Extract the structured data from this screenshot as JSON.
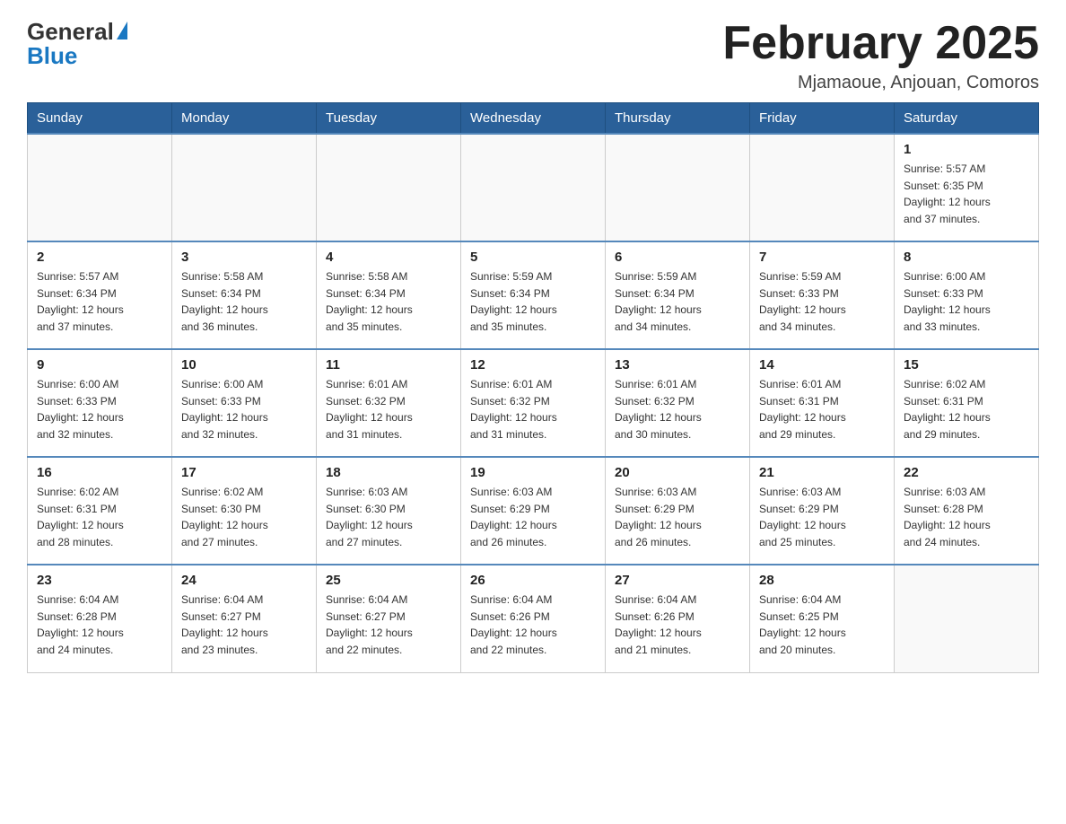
{
  "header": {
    "logo_general": "General",
    "logo_blue": "Blue",
    "month_title": "February 2025",
    "location": "Mjamaoue, Anjouan, Comoros"
  },
  "days_of_week": [
    "Sunday",
    "Monday",
    "Tuesday",
    "Wednesday",
    "Thursday",
    "Friday",
    "Saturday"
  ],
  "weeks": [
    [
      {
        "day": "",
        "info": ""
      },
      {
        "day": "",
        "info": ""
      },
      {
        "day": "",
        "info": ""
      },
      {
        "day": "",
        "info": ""
      },
      {
        "day": "",
        "info": ""
      },
      {
        "day": "",
        "info": ""
      },
      {
        "day": "1",
        "info": "Sunrise: 5:57 AM\nSunset: 6:35 PM\nDaylight: 12 hours\nand 37 minutes."
      }
    ],
    [
      {
        "day": "2",
        "info": "Sunrise: 5:57 AM\nSunset: 6:34 PM\nDaylight: 12 hours\nand 37 minutes."
      },
      {
        "day": "3",
        "info": "Sunrise: 5:58 AM\nSunset: 6:34 PM\nDaylight: 12 hours\nand 36 minutes."
      },
      {
        "day": "4",
        "info": "Sunrise: 5:58 AM\nSunset: 6:34 PM\nDaylight: 12 hours\nand 35 minutes."
      },
      {
        "day": "5",
        "info": "Sunrise: 5:59 AM\nSunset: 6:34 PM\nDaylight: 12 hours\nand 35 minutes."
      },
      {
        "day": "6",
        "info": "Sunrise: 5:59 AM\nSunset: 6:34 PM\nDaylight: 12 hours\nand 34 minutes."
      },
      {
        "day": "7",
        "info": "Sunrise: 5:59 AM\nSunset: 6:33 PM\nDaylight: 12 hours\nand 34 minutes."
      },
      {
        "day": "8",
        "info": "Sunrise: 6:00 AM\nSunset: 6:33 PM\nDaylight: 12 hours\nand 33 minutes."
      }
    ],
    [
      {
        "day": "9",
        "info": "Sunrise: 6:00 AM\nSunset: 6:33 PM\nDaylight: 12 hours\nand 32 minutes."
      },
      {
        "day": "10",
        "info": "Sunrise: 6:00 AM\nSunset: 6:33 PM\nDaylight: 12 hours\nand 32 minutes."
      },
      {
        "day": "11",
        "info": "Sunrise: 6:01 AM\nSunset: 6:32 PM\nDaylight: 12 hours\nand 31 minutes."
      },
      {
        "day": "12",
        "info": "Sunrise: 6:01 AM\nSunset: 6:32 PM\nDaylight: 12 hours\nand 31 minutes."
      },
      {
        "day": "13",
        "info": "Sunrise: 6:01 AM\nSunset: 6:32 PM\nDaylight: 12 hours\nand 30 minutes."
      },
      {
        "day": "14",
        "info": "Sunrise: 6:01 AM\nSunset: 6:31 PM\nDaylight: 12 hours\nand 29 minutes."
      },
      {
        "day": "15",
        "info": "Sunrise: 6:02 AM\nSunset: 6:31 PM\nDaylight: 12 hours\nand 29 minutes."
      }
    ],
    [
      {
        "day": "16",
        "info": "Sunrise: 6:02 AM\nSunset: 6:31 PM\nDaylight: 12 hours\nand 28 minutes."
      },
      {
        "day": "17",
        "info": "Sunrise: 6:02 AM\nSunset: 6:30 PM\nDaylight: 12 hours\nand 27 minutes."
      },
      {
        "day": "18",
        "info": "Sunrise: 6:03 AM\nSunset: 6:30 PM\nDaylight: 12 hours\nand 27 minutes."
      },
      {
        "day": "19",
        "info": "Sunrise: 6:03 AM\nSunset: 6:29 PM\nDaylight: 12 hours\nand 26 minutes."
      },
      {
        "day": "20",
        "info": "Sunrise: 6:03 AM\nSunset: 6:29 PM\nDaylight: 12 hours\nand 26 minutes."
      },
      {
        "day": "21",
        "info": "Sunrise: 6:03 AM\nSunset: 6:29 PM\nDaylight: 12 hours\nand 25 minutes."
      },
      {
        "day": "22",
        "info": "Sunrise: 6:03 AM\nSunset: 6:28 PM\nDaylight: 12 hours\nand 24 minutes."
      }
    ],
    [
      {
        "day": "23",
        "info": "Sunrise: 6:04 AM\nSunset: 6:28 PM\nDaylight: 12 hours\nand 24 minutes."
      },
      {
        "day": "24",
        "info": "Sunrise: 6:04 AM\nSunset: 6:27 PM\nDaylight: 12 hours\nand 23 minutes."
      },
      {
        "day": "25",
        "info": "Sunrise: 6:04 AM\nSunset: 6:27 PM\nDaylight: 12 hours\nand 22 minutes."
      },
      {
        "day": "26",
        "info": "Sunrise: 6:04 AM\nSunset: 6:26 PM\nDaylight: 12 hours\nand 22 minutes."
      },
      {
        "day": "27",
        "info": "Sunrise: 6:04 AM\nSunset: 6:26 PM\nDaylight: 12 hours\nand 21 minutes."
      },
      {
        "day": "28",
        "info": "Sunrise: 6:04 AM\nSunset: 6:25 PM\nDaylight: 12 hours\nand 20 minutes."
      },
      {
        "day": "",
        "info": ""
      }
    ]
  ]
}
